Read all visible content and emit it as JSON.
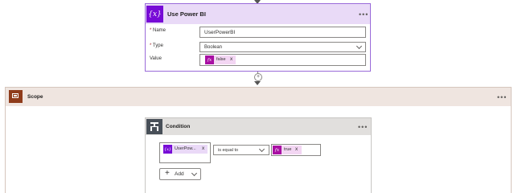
{
  "var_card": {
    "title": "Use Power BI",
    "icon": "{x}",
    "menu": "•••",
    "fields": {
      "name_label": "Name",
      "name_value": "UserPowerBI",
      "type_label": "Type",
      "type_value": "Boolean",
      "value_label": "Value",
      "value_token": "false",
      "required_mark": "*"
    }
  },
  "scope": {
    "title": "Scope",
    "menu": "•••"
  },
  "condition": {
    "title": "Condition",
    "menu": "•••",
    "left_token": "UserPow...",
    "operator": "is equal to",
    "right_token": "true",
    "add_label": "Add",
    "add_plus": "+"
  },
  "glyphs": {
    "fx": "fx",
    "x": "x",
    "var": "{x}",
    "plus": "+"
  },
  "colors": {
    "var_accent": "#770bd6",
    "var_header": "#e9daf7",
    "scope_accent": "#8f3c1b",
    "scope_header": "#efe5e0",
    "condition_accent": "#484f58",
    "condition_header": "#e1dfdd",
    "token_fx": "#a80fa3",
    "token_bg": "#f3d6f3"
  }
}
